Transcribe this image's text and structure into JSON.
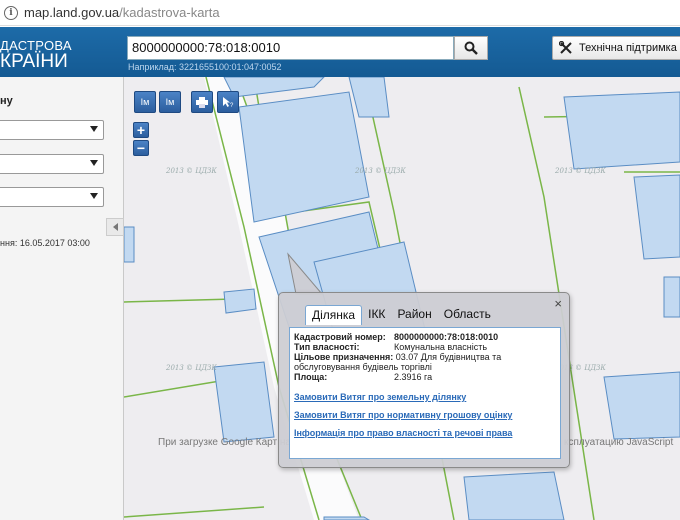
{
  "browser": {
    "url_host": "map.land.gov.ua",
    "url_path": "/kadastrova-karta"
  },
  "header": {
    "logo_line1": "ДАСТРОВА",
    "logo_line2": "КРАЇНИ",
    "search_value": "8000000000:78:018:0010",
    "example": "Наприклад: 3221655100:01:047:0052",
    "support_label": "Технічна підтримка"
  },
  "sidebar": {
    "label": "ну",
    "updated": "ння: 16.05.2017 03:00"
  },
  "map": {
    "tools": [
      "Ім",
      "Ім",
      "print-icon",
      "info-cursor-icon"
    ],
    "zoom_in": "+",
    "zoom_out": "−",
    "watermark": "2013 © ЦДЗК",
    "loading_left": "При загрузке Google Карт на",
    "loading_right": "ксплуатацию JavaScript"
  },
  "popup": {
    "tabs": [
      "Ділянка",
      "ІКК",
      "Район",
      "Область"
    ],
    "active_tab": "Ділянка",
    "close": "×",
    "fields": {
      "cadastral_label": "Кадастровий номер:",
      "cadastral_value": "8000000000:78:018:0010",
      "ownership_label": "Тип власності:",
      "ownership_value": "Комунальна власність",
      "purpose_label": "Цільове призначення:",
      "purpose_value": "03.07 Для будівництва та обслуговування будівель торгівлі",
      "area_label": "Площа:",
      "area_value": "2.3916 га"
    },
    "links": [
      "Замовити Витяг про земельну ділянку",
      "Замовити Витяг про нормативну грошову оцінку",
      "Інформація про право власності та речові права"
    ]
  },
  "colors": {
    "header": "#1d6ba8",
    "parcel_fill": "#c2d9f1",
    "parcel_stroke": "#5a8dc4",
    "border_green": "#7ab648"
  }
}
